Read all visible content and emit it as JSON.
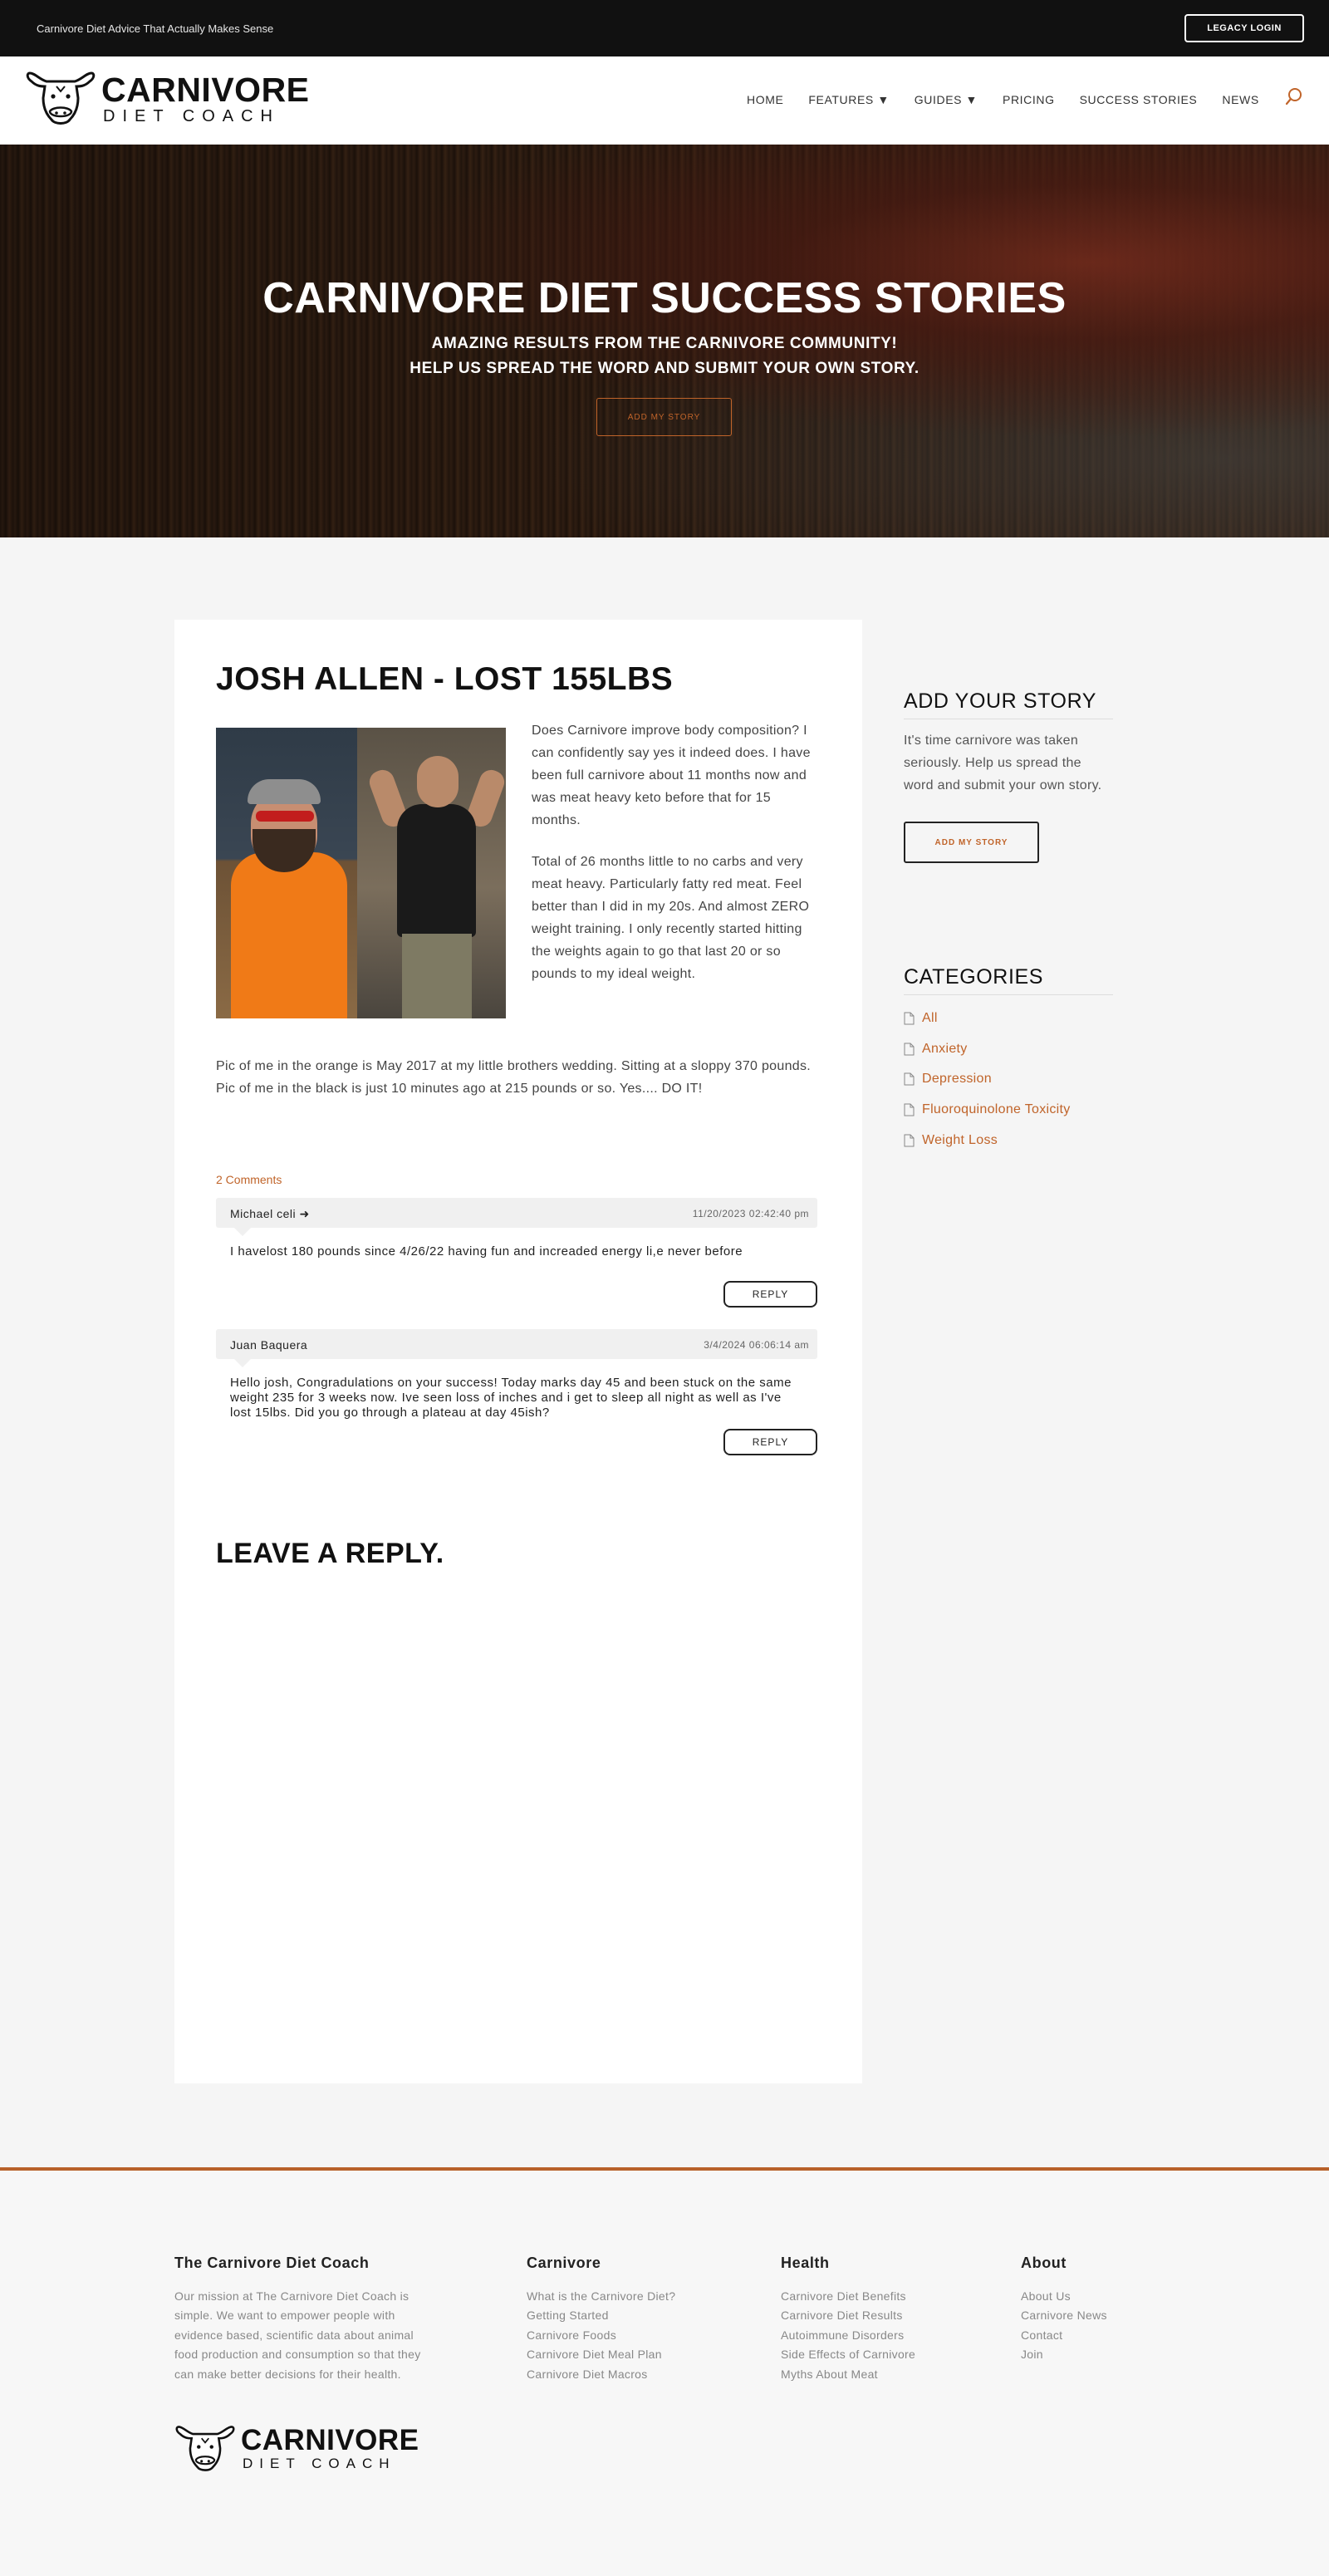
{
  "topbar": {
    "tagline": "Carnivore Diet Advice That Actually Makes Sense",
    "login_label": "LEGACY LOGIN"
  },
  "logo": {
    "line1": "CARNIVORE",
    "line2": "DIET COACH"
  },
  "nav": {
    "items": [
      "HOME",
      "FEATURES ▼",
      "GUIDES ▼",
      "PRICING",
      "SUCCESS STORIES",
      "NEWS"
    ]
  },
  "hero": {
    "title": "CARNIVORE DIET SUCCESS STORIES",
    "subtitle1": "AMAZING RESULTS FROM THE CARNIVORE COMMUNITY!",
    "subtitle2": "HELP US SPREAD THE WORD AND SUBMIT YOUR OWN STORY.",
    "button": "ADD MY STORY"
  },
  "post": {
    "title": "JOSH ALLEN - LOST 155LBS",
    "paragraph1": "Does Carnivore improve body composition? I can confidently say yes it indeed does. I have been full carnivore about 11 months now and was meat heavy keto before that for 15 months.",
    "paragraph2": "Total of 26 months little to no carbs and very meat heavy. Particularly fatty red meat. Feel better than I did in my 20s. And almost ZERO weight training. I only recently started hitting the weights again to go that last 20 or so pounds to my ideal weight.",
    "caption": "Pic of me in the orange is May 2017 at my little brothers wedding. Sitting at a sloppy 370 pounds. Pic of me in the black is just 10 minutes ago at 215 pounds or so. Yes.... DO IT!",
    "comments_count": "2 Comments",
    "comments": [
      {
        "author": "Michael celi ➜",
        "date": "11/20/2023 02:42:40 pm",
        "body": "I havelost 180 pounds since 4/26/22 having fun and increaded energy li,e never before",
        "reply": "REPLY"
      },
      {
        "author": "Juan Baquera",
        "date": "3/4/2024 06:06:14 am",
        "body": "Hello josh, Congradulations on your success! Today marks day 45 and been stuck on the same weight 235 for 3 weeks now. Ive seen loss of inches and i get to sleep all night as well as I've lost 15lbs. Did you go through a plateau at day 45ish?",
        "reply": "REPLY"
      }
    ],
    "leave_reply": "LEAVE A REPLY."
  },
  "sidebar": {
    "story_heading": "ADD YOUR STORY",
    "story_text": "It's time carnivore was taken seriously. Help us spread the word and submit your own story.",
    "story_button": "ADD MY STORY",
    "categories_heading": "CATEGORIES",
    "categories": [
      "All",
      "Anxiety",
      "Depression",
      "Fluoroquinolone Toxicity",
      "Weight Loss"
    ]
  },
  "footer": {
    "col1": {
      "heading": "The Carnivore Diet Coach",
      "lines": [
        "Our mission at The Carnivore Diet Coach is",
        "simple. We want to empower people with",
        "evidence based, scientific data about animal",
        "food production and consumption so that they",
        "can make better decisions for their health."
      ]
    },
    "col2": {
      "heading": "Carnivore",
      "links": [
        "What is the Carnivore Diet?",
        "Getting Started",
        "Carnivore Foods",
        "Carnivore Diet Meal Plan",
        "Carnivore Diet Macros"
      ]
    },
    "col3": {
      "heading": "Health",
      "links": [
        "Carnivore Diet Benefits",
        "Carnivore Diet Results",
        "Autoimmune Disorders",
        "Side Effects of Carnivore",
        "Myths About Meat"
      ]
    },
    "col4": {
      "heading": "About",
      "links": [
        "About Us",
        "Carnivore News",
        "Contact",
        "Join"
      ]
    }
  },
  "colors": {
    "accent": "#c0642a",
    "topbar": "#111111",
    "footer_rule": "#b8612a"
  },
  "icons": {
    "search": "search-icon",
    "logo": "cow-head-icon",
    "category": "document-icon"
  }
}
